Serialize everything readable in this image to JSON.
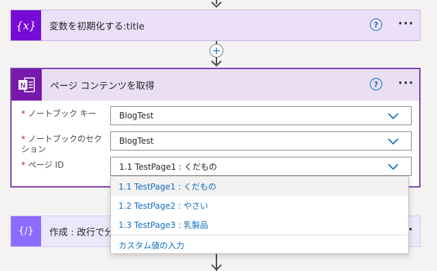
{
  "variable_card": {
    "title": "変数を初期化する:title",
    "icon": "variable-icon",
    "color": "#770bd6"
  },
  "onenote_card": {
    "title": "ページ コンテンツを取得",
    "icon": "onenote-icon",
    "color": "#7719aa",
    "fields": [
      {
        "label": "ノートブック キー",
        "value": "BlogTest",
        "required": "*"
      },
      {
        "label": "ノートブックのセクション",
        "value": "BlogTest",
        "required": "*"
      },
      {
        "label": "ページ ID",
        "value": "1.1 TestPage1 : くだもの",
        "required": "*"
      }
    ]
  },
  "dropdown": {
    "options": [
      "1.1 TestPage1 : くだもの",
      "1.2 TestPage2 : やさい",
      "1.3 TestPage3 : 乳製品"
    ],
    "custom_value": "カスタム値の入力"
  },
  "compose_card": {
    "title": "作成 : 改行で分",
    "icon": "compose-icon",
    "color": "#8c6cff"
  },
  "add_step_icon": "+",
  "help_label": "?",
  "more_label": "···"
}
